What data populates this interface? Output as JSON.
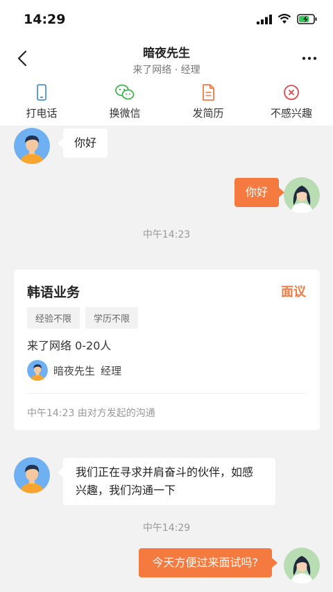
{
  "status_bar": {
    "time": "14:29"
  },
  "nav": {
    "title": "暗夜先生",
    "subtitle": "来了网络 · 经理"
  },
  "actions": [
    {
      "label": "打电话",
      "icon": "phone-icon"
    },
    {
      "label": "换微信",
      "icon": "wechat-icon"
    },
    {
      "label": "发简历",
      "icon": "resume-icon"
    },
    {
      "label": "不感兴趣",
      "icon": "not-interested-icon"
    }
  ],
  "messages": {
    "m1": "你好",
    "m2": "你好",
    "t1": "中午14:23",
    "m3": "我们正在寻求并肩奋斗的伙伴，如感兴趣，我们沟通一下",
    "t2": "中午14:29",
    "m4": "今天方便过来面试吗?"
  },
  "job_card": {
    "title": "韩语业务",
    "salary": "面议",
    "tags": [
      "经验不限",
      "学历不限"
    ],
    "company_line": "来了网络   0-20人",
    "recruiter_name": "暗夜先生",
    "recruiter_title": "经理",
    "footer": "中午14:23 由对方发起的沟通"
  },
  "colors": {
    "accent": "#f47a3f",
    "background": "#f2f2f2"
  }
}
